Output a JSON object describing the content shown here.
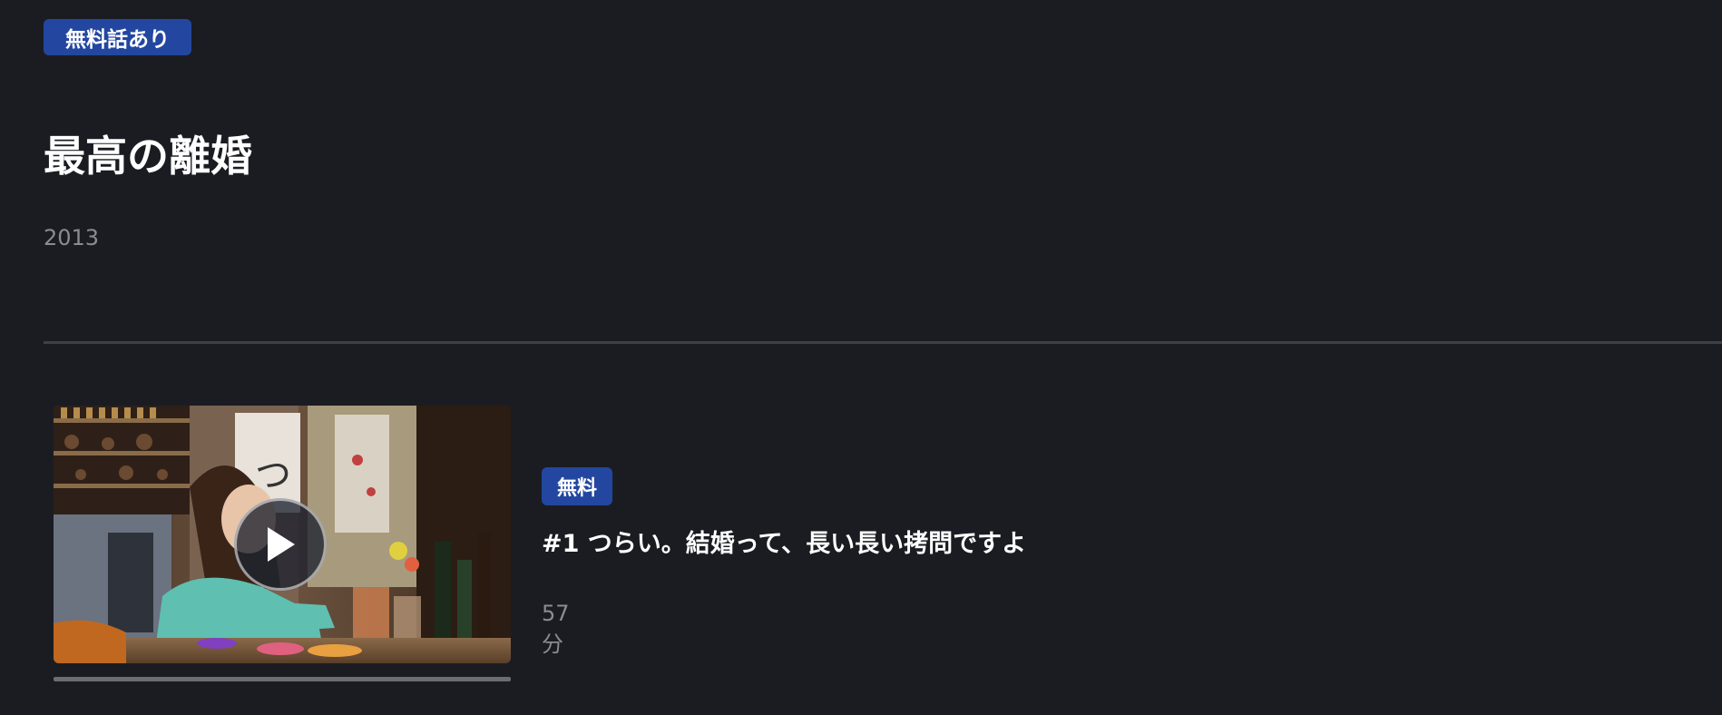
{
  "series": {
    "free_badge": "無料話あり",
    "title": "最高の離婚",
    "year": "2013"
  },
  "episodes": [
    {
      "badge": "無料",
      "title": "#1 つらい。結婚って、長い長い拷問ですよ",
      "duration": "57分",
      "thumbnail_icon": "play-icon",
      "watch_progress": 0
    }
  ],
  "colors": {
    "background": "#1b1c22",
    "badge": "#2347a0",
    "muted_text": "#8b8c91",
    "divider": "#3f4047"
  }
}
